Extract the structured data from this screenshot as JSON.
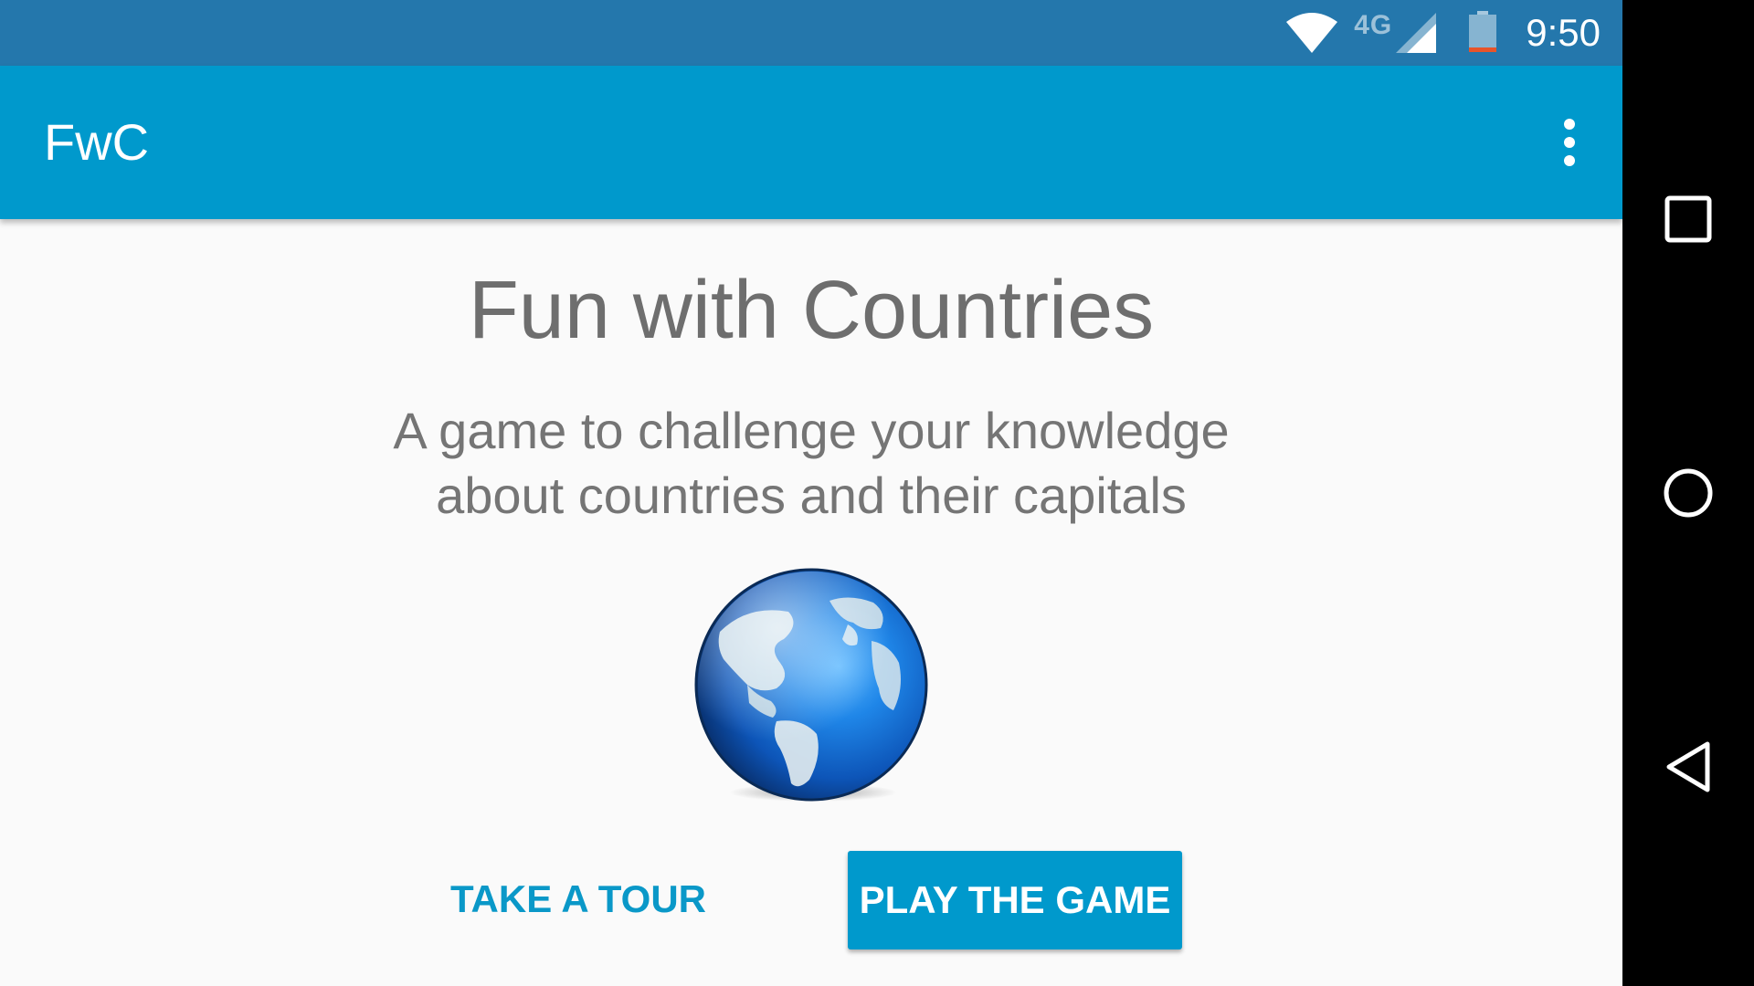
{
  "status_bar": {
    "network_label": "4G",
    "time": "9:50",
    "icons": [
      "wifi-icon",
      "cell-signal-icon",
      "battery-icon"
    ],
    "battery_low_color": "#e8542a"
  },
  "app_bar": {
    "title": "FwC",
    "menu_icon": "more-vert-icon"
  },
  "main": {
    "headline": "Fun with Countries",
    "subtitle": "A game to challenge your knowledge about countries and their capitals",
    "image": "globe-icon",
    "buttons": {
      "tour_label": "TAKE A TOUR",
      "play_label": "PLAY THE GAME"
    }
  },
  "nav_bar": {
    "items": [
      "recents-icon",
      "home-icon",
      "back-icon"
    ]
  },
  "colors": {
    "status_bar": "#2477ac",
    "app_bar": "#0099cc",
    "accent": "#0099cc",
    "text_gray": "#757575",
    "background": "#fafafa"
  }
}
